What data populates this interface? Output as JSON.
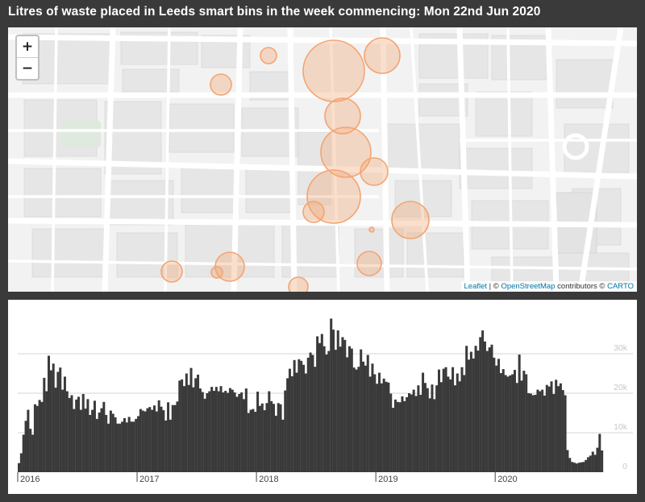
{
  "title": "Litres of waste placed in Leeds smart bins in the week commencing: Mon 22nd Jun 2020",
  "map": {
    "zoom_in_label": "+",
    "zoom_out_label": "−",
    "attribution": {
      "leaflet": "Leaflet",
      "sep1": " | © ",
      "osm": "OpenStreetMap",
      "contributors": " contributors © ",
      "carto": "CARTO"
    },
    "bubble_color": "#f4a470",
    "bubbles": [
      {
        "cx": 404,
        "cy": 54,
        "r": 38
      },
      {
        "cx": 464,
        "cy": 35,
        "r": 22
      },
      {
        "cx": 323,
        "cy": 35,
        "r": 10
      },
      {
        "cx": 264,
        "cy": 71,
        "r": 13
      },
      {
        "cx": 415,
        "cy": 110,
        "r": 22
      },
      {
        "cx": 419,
        "cy": 155,
        "r": 31
      },
      {
        "cx": 454,
        "cy": 179,
        "r": 17
      },
      {
        "cx": 404,
        "cy": 210,
        "r": 33
      },
      {
        "cx": 379,
        "cy": 229,
        "r": 13
      },
      {
        "cx": 499,
        "cy": 239,
        "r": 23
      },
      {
        "cx": 451,
        "cy": 251,
        "r": 3
      },
      {
        "cx": 448,
        "cy": 293,
        "r": 15
      },
      {
        "cx": 275,
        "cy": 297,
        "r": 18
      },
      {
        "cx": 259,
        "cy": 304,
        "r": 7
      },
      {
        "cx": 203,
        "cy": 303,
        "r": 13
      },
      {
        "cx": 360,
        "cy": 322,
        "r": 12
      }
    ]
  },
  "chart_data": {
    "type": "bar",
    "color": "#3a3a3a",
    "grid": true,
    "x_labels": [
      "2016",
      "2017",
      "2018",
      "2019",
      "2020"
    ],
    "y_ticks": [
      0,
      10000,
      20000,
      30000
    ],
    "y_tick_labels": [
      "0",
      "10k",
      "20k",
      "30k"
    ],
    "ylim": [
      0,
      40000
    ],
    "weeks_start": "2016-01-04",
    "values": [
      2300,
      4800,
      9500,
      13000,
      15800,
      11000,
      9500,
      17200,
      16800,
      18300,
      17800,
      23900,
      20500,
      29500,
      25800,
      27500,
      21400,
      25400,
      26500,
      20900,
      24200,
      20500,
      18800,
      19500,
      16000,
      18400,
      19100,
      15800,
      19800,
      16100,
      18500,
      14500,
      15800,
      18100,
      13500,
      15100,
      16200,
      17800,
      14500,
      12300,
      15600,
      14800,
      13900,
      12300,
      12300,
      12800,
      13700,
      12600,
      14000,
      12800,
      12800,
      13500,
      14200,
      16000,
      15600,
      15400,
      16200,
      16500,
      15800,
      16900,
      15400,
      18200,
      16600,
      15700,
      13100,
      17700,
      13300,
      17000,
      17000,
      17900,
      23200,
      23500,
      21800,
      25000,
      22100,
      26400,
      21500,
      23800,
      24700,
      21200,
      20300,
      18600,
      20000,
      20500,
      21600,
      20600,
      21600,
      20500,
      21800,
      20200,
      20600,
      20100,
      21300,
      20900,
      20200,
      19100,
      19800,
      20200,
      18500,
      21200,
      15000,
      15800,
      16000,
      15300,
      20400,
      16800,
      17400,
      15700,
      17500,
      20500,
      18000,
      17300,
      14300,
      17500,
      17200,
      13300,
      20700,
      23800,
      26200,
      24300,
      28400,
      25200,
      28600,
      28200,
      27200,
      25000,
      29000,
      30300,
      29700,
      26700,
      34400,
      32700,
      35000,
      31900,
      29800,
      30700,
      38900,
      36100,
      31000,
      35900,
      31800,
      34200,
      33500,
      29100,
      31900,
      31300,
      26500,
      26000,
      26700,
      31100,
      28000,
      27000,
      29700,
      24200,
      27500,
      24800,
      22400,
      25200,
      22500,
      23700,
      22900,
      22700,
      19900,
      16300,
      18400,
      17800,
      17700,
      19200,
      18000,
      19000,
      20000,
      19700,
      20900,
      19300,
      22000,
      19600,
      25200,
      22600,
      21300,
      18700,
      22200,
      18500,
      22000,
      26000,
      22800,
      26200,
      26600,
      24200,
      23500,
      26600,
      22000,
      25000,
      23000,
      26600,
      24600,
      32000,
      28500,
      30500,
      28800,
      32000,
      30800,
      34200,
      35900,
      33100,
      30700,
      31600,
      32300,
      29000,
      27000,
      28700,
      25100,
      26100,
      24600,
      24200,
      24500,
      24800,
      25900,
      22600,
      29800,
      23200,
      25700,
      24800,
      20000,
      19900,
      19500,
      19600,
      20900,
      20500,
      20900,
      19400,
      22100,
      21700,
      23000,
      19800,
      23400,
      21800,
      22500,
      20800,
      19500,
      5600,
      3600,
      2600,
      2400,
      2200,
      2400,
      2500,
      2600,
      3100,
      3800,
      4200,
      5200,
      4400,
      6200,
      9700,
      5500
    ]
  }
}
